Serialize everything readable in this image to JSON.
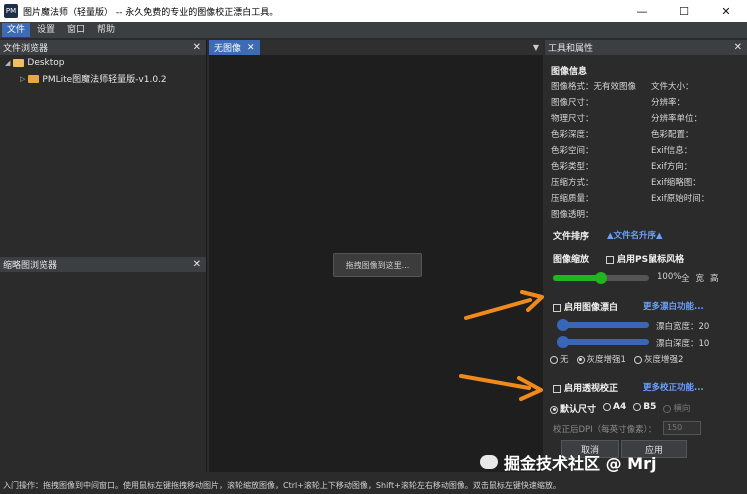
{
  "window": {
    "title": "图片魔法师（轻量版） -- 永久免费的专业的图像校正漂白工具。",
    "app_icon_text": "PM",
    "minimize": "—",
    "maximize": "☐",
    "close": "✕"
  },
  "menu": [
    "文件",
    "设置",
    "窗口",
    "帮助"
  ],
  "file_browser": {
    "title": "文件浏览器",
    "items": [
      {
        "label": "Desktop"
      },
      {
        "label": "PMLite图魔法师轻量版-v1.0.2"
      }
    ]
  },
  "thumb_browser": {
    "title": "缩略图浏览器"
  },
  "center": {
    "tab_label": "无图像",
    "drop_hint": "拖拽图像到这里..."
  },
  "tools": {
    "title": "工具和属性",
    "info_title": "图像信息",
    "info_left": [
      {
        "label": "图像格式：",
        "value": "无有效图像"
      },
      {
        "label": "图像尺寸：",
        "value": ""
      },
      {
        "label": "物理尺寸：",
        "value": ""
      },
      {
        "label": "色彩深度：",
        "value": ""
      },
      {
        "label": "色彩空间：",
        "value": ""
      },
      {
        "label": "色彩类型：",
        "value": ""
      },
      {
        "label": "压缩方式：",
        "value": ""
      },
      {
        "label": "压缩质量：",
        "value": ""
      },
      {
        "label": "图像透明：",
        "value": ""
      }
    ],
    "info_right": [
      "文件大小：",
      "分辨率：",
      "分辨率单位：",
      "色彩配置：",
      "Exif信息：",
      "Exif方向：",
      "Exif缩略图：",
      "Exif原始时间："
    ],
    "sort_label": "文件排序",
    "sort_value": "▲文件名升序▲",
    "zoom_label": "图像缩放",
    "ps_style_label": "启用PS鼠标风格",
    "zoom_percent": "100%",
    "zoom_fraction": 0.5,
    "zoom_modes": [
      "全",
      "宽",
      "高"
    ],
    "whiten_label": "启用图像漂白",
    "whiten_more": "更多漂白功能...",
    "whiten_width_label": "漂白宽度：",
    "whiten_width_value": "20",
    "whiten_width_fraction": 0.0,
    "whiten_depth_label": "漂白深度：",
    "whiten_depth_value": "10",
    "whiten_depth_fraction": 0.0,
    "gray_options": [
      "无",
      "灰度增强1",
      "灰度增强2"
    ],
    "gray_selected": 1,
    "perspective_label": "启用透视校正",
    "perspective_more": "更多校正功能...",
    "size_options": [
      "默认尺寸",
      "A4",
      "B5",
      "横向"
    ],
    "size_selected": 0,
    "dpi_label": "校正后DPI（每英寸像素）：",
    "dpi_value": "150",
    "cancel_label": "取消",
    "apply_label": "应用"
  },
  "status": "入门操作：拖拽图像到中间窗口。使用鼠标左键拖拽移动图片，滚轮缩放图像，Ctrl+滚轮上下移动图像，Shift+滚轮左右移动图像。双击鼠标左键快速缩放。",
  "watermark": "掘金技术社区 @ Mrj",
  "colors": {
    "accent": "#3d6bb5",
    "link": "#6ca0ff",
    "zoom_slider": "#21b521",
    "whiten_slider": "#3a66b8",
    "annotation_arrow": "#f08a1c"
  }
}
